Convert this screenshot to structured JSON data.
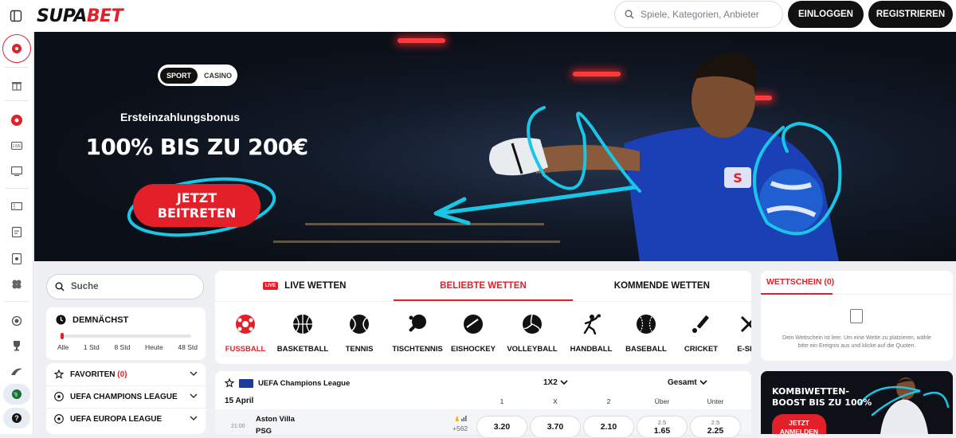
{
  "header": {
    "logo_part1": "SUPA",
    "logo_part2": "BET",
    "search_placeholder": "Spiele, Kategorien, Anbieter",
    "login_label": "EINLOGGEN",
    "register_label": "REGISTRIEREN"
  },
  "sidebar": {
    "icons": [
      "sport-icon",
      "gift-icon",
      "casino-icon",
      "live-icon",
      "tv-icon",
      "ticket-icon",
      "calendar-icon",
      "card-icon",
      "clover-icon",
      "badge-icon",
      "trophy-icon",
      "promo-icon",
      "globe-icon",
      "help-icon"
    ]
  },
  "hero": {
    "toggle_sport": "SPORT",
    "toggle_casino": "CASINO",
    "subtitle": "Ersteinzahlungsbonus",
    "title": "100% BIS ZU 200€",
    "cta_line1": "JETZT",
    "cta_line2": "BEITRETEN"
  },
  "left": {
    "search_label": "Suche",
    "soon_label": "DEMNÄCHST",
    "soon_ticks": [
      "Alle",
      "1 Std",
      "8 Std",
      "Heute",
      "48 Std"
    ],
    "favorites_label": "FAVORITEN",
    "favorites_count": "(0)",
    "league1": "UEFA CHAMPIONS LEAGUE",
    "league2": "UEFA EUROPA LEAGUE"
  },
  "center": {
    "tabs": [
      "LIVE WETTEN",
      "BELIEBTE WETTEN",
      "KOMMENDE WETTEN"
    ],
    "live_badge": "LIVE",
    "sports": [
      "FUSSBALL",
      "BASKETBALL",
      "TENNIS",
      "TISCHTENNIS",
      "EISHOCKEY",
      "VOLLEYBALL",
      "HANDBALL",
      "BASEBALL",
      "CRICKET",
      "E-SPO"
    ]
  },
  "match": {
    "league": "UEFA Champions League",
    "market": "1X2",
    "market2": "Gesamt",
    "date": "15 April",
    "col_1": "1",
    "col_x": "X",
    "col_2": "2",
    "col_over": "Über",
    "col_under": "Unter",
    "time": "21:00",
    "home": "Aston Villa",
    "away": "PSG",
    "more_markets": "+562",
    "odd_1": "3.20",
    "odd_x": "3.70",
    "odd_2": "2.10",
    "over_line": "2.5",
    "over_odd": "1.65",
    "under_line": "2.5",
    "under_odd": "2.25"
  },
  "slip": {
    "title": "WETTSCHEIN (0)",
    "empty_msg": "Dein Wettschein ist leer. Um eine Wette zu platzieren, wähle bitte ein Ereignis aus und klicke auf die Quoten."
  },
  "promo": {
    "title": "KOMBIWETTEN-BOOST BIS ZU 100%",
    "cta": "JETZT ANMELDEN"
  },
  "colors": {
    "brand_red": "#e3202a",
    "accent_cyan": "#19c6e6",
    "dark": "#111111"
  }
}
